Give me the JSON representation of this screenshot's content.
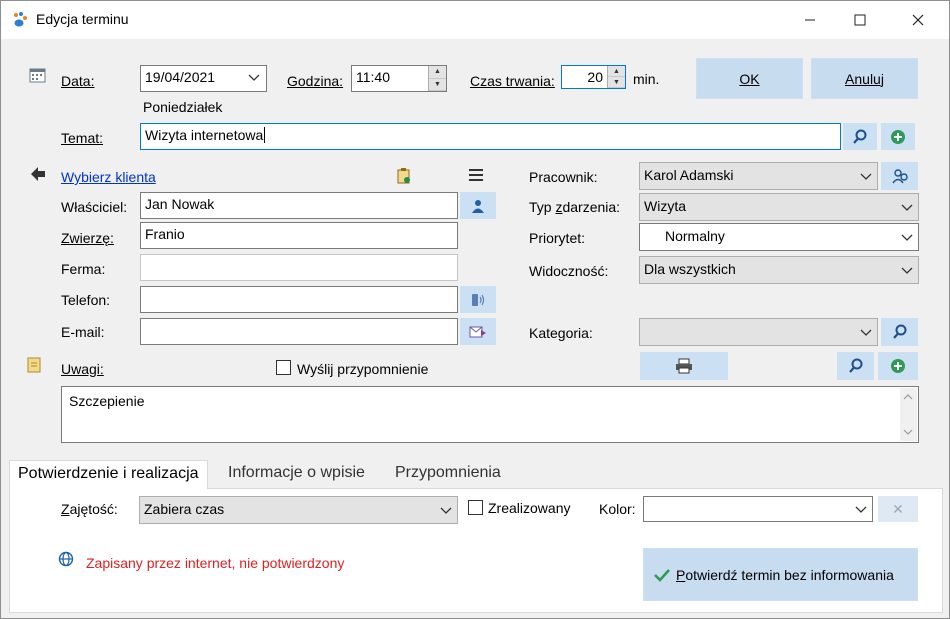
{
  "window": {
    "title": "Edycja terminu",
    "minimize": "—",
    "maximize": "☐",
    "close": "✕"
  },
  "form": {
    "date_label": "Data:",
    "date_value": "19/04/2021",
    "weekday": "Poniedziałek",
    "hour_label": "Godzina:",
    "hour_value": "11:40",
    "duration_label": "Czas trwania:",
    "duration_value": "20",
    "duration_unit": "min.",
    "ok_label": "OK",
    "cancel_label": "Anuluj",
    "subject_label": "Temat:",
    "subject_value": "Wizyta internetowa",
    "choose_client": "Wybierz klienta",
    "owner_label": "Właściciel:",
    "owner_value": "Jan Nowak",
    "animal_label": "Zwierzę:",
    "animal_value": "Franio",
    "company_label": "Ferma:",
    "company_value": "",
    "phone_label": "Telefon:",
    "phone_value": "",
    "email_label": "E-mail:",
    "email_value": "",
    "employee_label": "Pracownik:",
    "employee_value": "Karol Adamski",
    "event_type_label": "Typ zdarzenia:",
    "event_type_value": "Wizyta",
    "priority_label": "Priorytet:",
    "priority_value": "Normalny",
    "visibility_label": "Widoczność:",
    "visibility_value": "Dla wszystkich",
    "category_label": "Kategoria:",
    "category_value": "",
    "notes_label": "Uwagi:",
    "send_reminder_label": "Wyślij przypomnienie",
    "send_reminder_checked": false,
    "notes_value": "Szczepienie"
  },
  "tabs": [
    {
      "label": "Potwierdzenie i realizacja",
      "active": true
    },
    {
      "label": "Informacje o wpisie",
      "active": false
    },
    {
      "label": "Przypomnienia",
      "active": false
    }
  ],
  "tab_panel": {
    "occupancy_label": "Zajętość:",
    "occupancy_value": "Zabiera czas",
    "realized_label": "Zrealizowany",
    "realized_checked": false,
    "color_label": "Kolor:",
    "color_value": "",
    "clear_color": "✕",
    "status_text": "Zapisany przez internet, nie potwierdzony",
    "confirm_label": "Potwierdź termin bez informowania"
  },
  "colors": {
    "accent_button": "#cce0f3",
    "status_red": "#e02020",
    "link_blue": "#0033cc",
    "confirm_check": "#2e9a56"
  }
}
